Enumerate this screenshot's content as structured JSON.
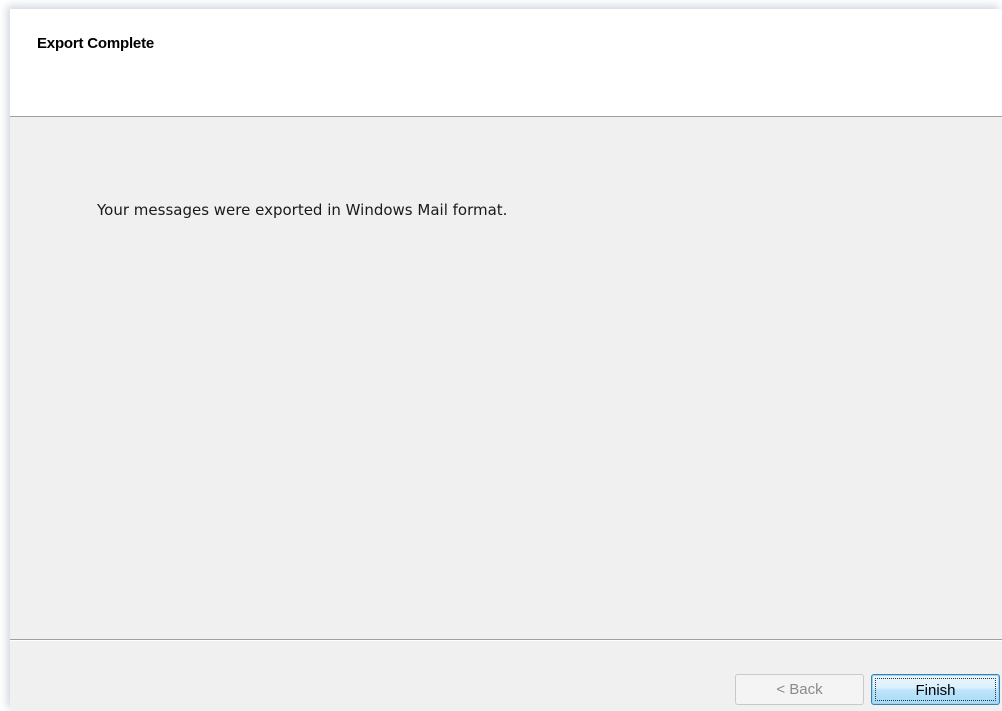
{
  "wizard": {
    "header_title": "Export Complete",
    "message": "Your messages were exported in Windows Mail format.",
    "buttons": {
      "back_label": "< Back",
      "finish_label": "Finish"
    }
  }
}
